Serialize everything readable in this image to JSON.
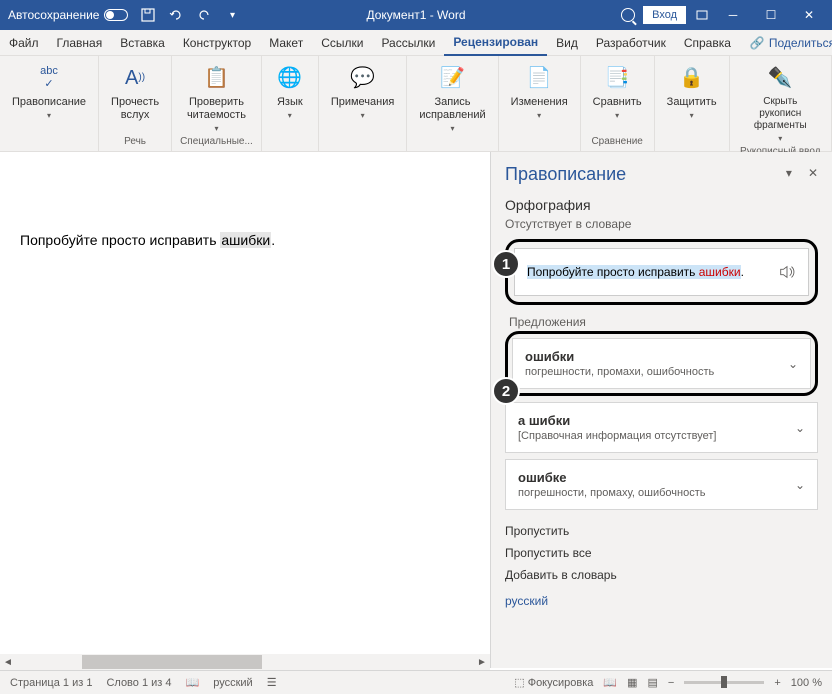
{
  "titlebar": {
    "autosave": "Автосохранение",
    "doc_title": "Документ1 - Word",
    "login": "Вход"
  },
  "tabs": {
    "file": "Файл",
    "home": "Главная",
    "insert": "Вставка",
    "design": "Конструктор",
    "layout": "Макет",
    "refs": "Ссылки",
    "mail": "Рассылки",
    "review": "Рецензирован",
    "view": "Вид",
    "dev": "Разработчик",
    "help": "Справка",
    "share": "Поделиться"
  },
  "ribbon": {
    "spelling": "Правописание",
    "read_aloud": "Прочесть\nвслух",
    "readability": "Проверить\nчитаемость",
    "language": "Язык",
    "comments": "Примечания",
    "track": "Запись\nисправлений",
    "changes": "Изменения",
    "compare": "Сравнить",
    "protect": "Защитить",
    "ink": "Скрыть рукописн\nфрагменты",
    "g_speech": "Речь",
    "g_special": "Специальные...",
    "g_compare": "Сравнение",
    "g_ink": "Рукописный ввод"
  },
  "doc": {
    "text_before": "Попробуйте просто исправить ",
    "err": "ашибки",
    "text_after": "."
  },
  "panel": {
    "title": "Правописание",
    "type": "Орфография",
    "not_in_dict": "Отсутствует в словаре",
    "context_before": "Попробуйте просто исправить ",
    "context_err": "ашибки",
    "context_after": ".",
    "sugg_label": "Предложения",
    "sugg1": {
      "word": "ошибки",
      "syn": "погрешности, промахи, ошибочность"
    },
    "sugg2": {
      "word": "а шибки",
      "syn": "[Справочная информация отсутствует]"
    },
    "sugg3": {
      "word": "ошибке",
      "syn": "погрешности, промаху, ошибочность"
    },
    "skip": "Пропустить",
    "skip_all": "Пропустить все",
    "add_dict": "Добавить в словарь",
    "lang": "русский"
  },
  "status": {
    "page": "Страница 1 из 1",
    "words": "Слово 1 из 4",
    "lang": "русский",
    "focus": "Фокусировка",
    "zoom": "100 %"
  },
  "callouts": {
    "n1": "1",
    "n2": "2"
  }
}
